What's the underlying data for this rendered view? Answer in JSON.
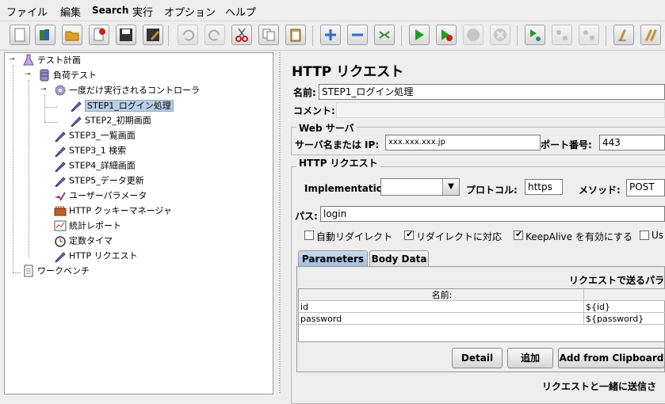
{
  "menubar": {
    "items": [
      "ファイル",
      "編集",
      "Search",
      "実行",
      "オプション",
      "ヘルプ"
    ]
  },
  "toolbar": {
    "buttons": [
      "new-icon",
      "templates-icon",
      "open-icon",
      "close-icon",
      "save-icon",
      "save-as-icon",
      "undo-icon",
      "redo-icon",
      "cut-icon",
      "copy-icon",
      "paste-icon",
      "expand-icon",
      "collapse-icon",
      "toggle-icon",
      "start-icon",
      "start-no-pause-icon",
      "stop-icon",
      "shutdown-icon",
      "remote-start-icon",
      "remote-stop-icon",
      "remote-shutdown-icon",
      "clear-icon",
      "clear-all-icon"
    ]
  },
  "tree": {
    "nodes": [
      {
        "label": "テスト計画",
        "icon": "flask-icon"
      },
      {
        "label": "負荷テスト",
        "icon": "spool-icon"
      },
      {
        "label": "一度だけ実行されるコントローラ",
        "icon": "gear-icon"
      },
      {
        "label": "STEP1_ログイン処理",
        "icon": "pipette-icon"
      },
      {
        "label": "STEP2_初期画面",
        "icon": "pipette-icon"
      },
      {
        "label": "STEP3_一覧画面",
        "icon": "pipette-icon"
      },
      {
        "label": "STEP3_1 検索",
        "icon": "pipette-icon"
      },
      {
        "label": "STEP4_詳細画面",
        "icon": "pipette-icon"
      },
      {
        "label": "STEP5_データ更新",
        "icon": "pipette-icon"
      },
      {
        "label": "ユーザーパラメータ",
        "icon": "param-icon"
      },
      {
        "label": "HTTP クッキーマネージャ",
        "icon": "cookie-icon"
      },
      {
        "label": "統計レポート",
        "icon": "report-icon"
      },
      {
        "label": "定数タイマ",
        "icon": "timer-icon"
      },
      {
        "label": "HTTP リクエスト",
        "icon": "pipette-icon"
      },
      {
        "label": "ワークベンチ",
        "icon": "clipboard-icon"
      }
    ]
  },
  "panel": {
    "title": "HTTP リクエスト",
    "name_label": "名前:",
    "name_value": "STEP1_ログイン処理",
    "comment_label": "コメント:",
    "comment_value": "",
    "webserver": {
      "legend": "Web サーバ",
      "server_label": "サーバ名または IP:",
      "server_value": "xxx.xxx.xxx.jp",
      "port_label": "ポート番号:",
      "port_value": "443"
    },
    "http": {
      "legend": "HTTP リクエスト",
      "impl_label": "Implementation:",
      "impl_value": "",
      "protocol_label": "プロトコル:",
      "protocol_value": "https",
      "method_label": "メソッド:",
      "method_value": "POST",
      "path_label": "パス:",
      "path_value": "login",
      "checkboxes": [
        {
          "label": "自動リダイレクト",
          "checked": false
        },
        {
          "label": "リダイレクトに対応",
          "checked": true
        },
        {
          "label": "KeepAlive を有効にする",
          "checked": true
        },
        {
          "label": "Us",
          "checked": false
        }
      ]
    },
    "tabs": {
      "parameters": "Parameters",
      "body": "Body Data"
    },
    "params": {
      "heading": "リクエストで送るパラ",
      "col_name": "名前:",
      "col_value": "",
      "rows": [
        {
          "name": "id",
          "value": "${id}"
        },
        {
          "name": "password",
          "value": "${password}"
        }
      ]
    },
    "buttons": {
      "detail": "Detail",
      "add": "追加",
      "clipboard": "Add from Clipboard"
    },
    "footer_text": "リクエストと一緒に送信さ"
  }
}
